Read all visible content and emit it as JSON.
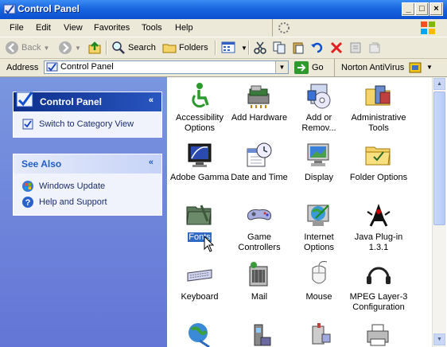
{
  "window": {
    "title": "Control Panel"
  },
  "menu": {
    "items": [
      "File",
      "Edit",
      "View",
      "Favorites",
      "Tools",
      "Help"
    ]
  },
  "toolbar": {
    "back": "Back",
    "search": "Search",
    "folders": "Folders"
  },
  "address": {
    "label": "Address",
    "value": "Control Panel",
    "go": "Go",
    "norton": "Norton AntiVirus"
  },
  "sidebar": {
    "control_panel_title": "Control Panel",
    "switch_view": "Switch to Category View",
    "see_also_title": "See Also",
    "windows_update": "Windows Update",
    "help_support": "Help and Support"
  },
  "items": [
    {
      "label": "Accessibility Options",
      "icon": "accessibility-icon"
    },
    {
      "label": "Add Hardware",
      "icon": "add-hardware-icon"
    },
    {
      "label": "Add or Remov...",
      "icon": "add-remove-programs-icon"
    },
    {
      "label": "Administrative Tools",
      "icon": "administrative-tools-icon"
    },
    {
      "label": "Adobe Gamma",
      "icon": "adobe-gamma-icon"
    },
    {
      "label": "Date and Time",
      "icon": "date-time-icon"
    },
    {
      "label": "Display",
      "icon": "display-icon"
    },
    {
      "label": "Folder Options",
      "icon": "folder-options-icon"
    },
    {
      "label": "Fonts",
      "icon": "fonts-icon"
    },
    {
      "label": "Game Controllers",
      "icon": "game-controllers-icon"
    },
    {
      "label": "Internet Options",
      "icon": "internet-options-icon"
    },
    {
      "label": "Java Plug-in 1.3.1",
      "icon": "java-plugin-icon"
    },
    {
      "label": "Keyboard",
      "icon": "keyboard-icon"
    },
    {
      "label": "Mail",
      "icon": "mail-icon"
    },
    {
      "label": "Mouse",
      "icon": "mouse-icon"
    },
    {
      "label": "MPEG Layer-3 Configuration",
      "icon": "mpeg-layer3-icon"
    }
  ],
  "colors": {
    "title_bar": "#0a4fd0",
    "sidebar_bg": "#6375d6",
    "panel_head": "#1c3f94",
    "selection": "#316ac5"
  }
}
